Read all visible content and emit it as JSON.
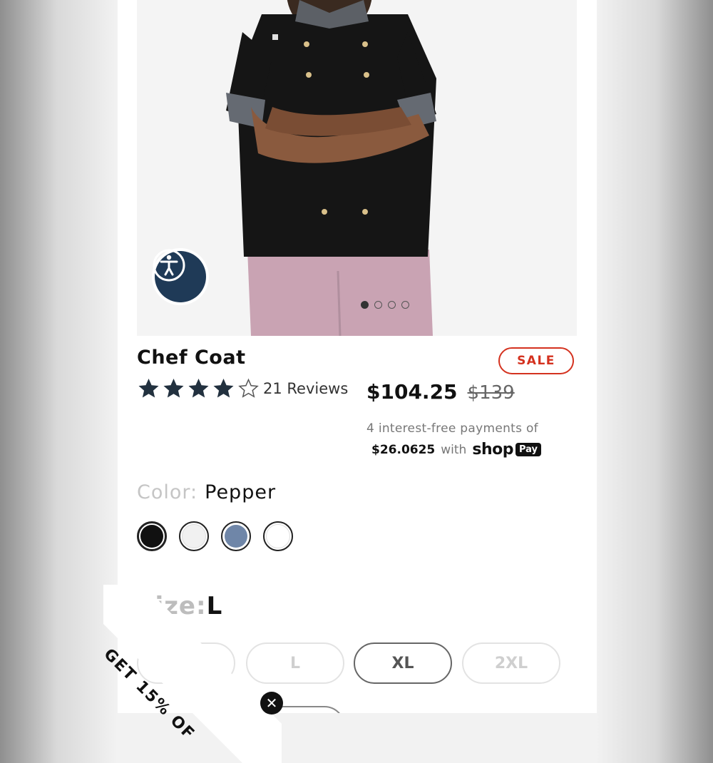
{
  "product": {
    "title": "Chef Coat",
    "sale_badge": "SALE",
    "rating": 4,
    "rating_max": 5,
    "reviews_label": "21 Reviews",
    "price": "$104.25",
    "original_price": "$139",
    "installments_line": "4 interest-free payments of",
    "installment_amount": "$26.0625",
    "installment_with": "with",
    "shop_word": "shop",
    "pay_word": "Pay"
  },
  "gallery": {
    "image_count": 4,
    "active_index": 0,
    "accessibility_icon": "accessibility-icon"
  },
  "color": {
    "label": "Color:",
    "selected": "Pepper",
    "swatches": [
      {
        "color": "#111111",
        "selected": true
      },
      {
        "color": "#f1f1f1",
        "selected": false
      },
      {
        "color": "#6f86a8",
        "selected": false
      },
      {
        "color": "#ffffff",
        "selected": false
      }
    ]
  },
  "size": {
    "label": "Size:",
    "selected": "L",
    "options": [
      "M",
      "L",
      "XL",
      "2XL"
    ],
    "available": [
      "XL"
    ]
  },
  "promo": {
    "text": "GET 15% OF",
    "close_icon": "close-icon"
  },
  "colors": {
    "sale_red": "#d4321f",
    "accessibility_navy": "#1f3a57"
  }
}
